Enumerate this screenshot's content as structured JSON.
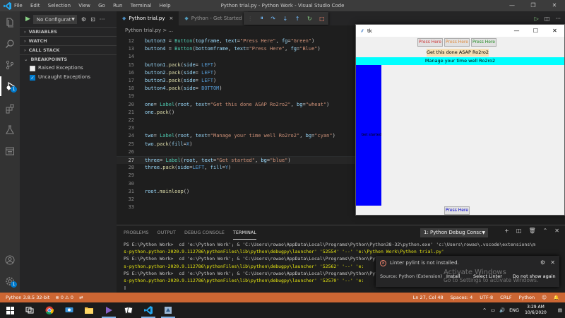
{
  "titlebar": {
    "menu": [
      "File",
      "Edit",
      "Selection",
      "View",
      "Go",
      "Run",
      "Terminal",
      "Help"
    ],
    "title": "Python trial.py - Python Work - Visual Studio Code"
  },
  "sidebar": {
    "config": "No Configurat",
    "sections": [
      "VARIABLES",
      "WATCH",
      "CALL STACK",
      "BREAKPOINTS"
    ],
    "breakpoints": [
      {
        "label": "Raised Exceptions",
        "checked": false
      },
      {
        "label": "Uncaught Exceptions",
        "checked": true
      }
    ]
  },
  "tabs": [
    {
      "label": "Python trial.py",
      "active": true
    },
    {
      "label": "Python - Get Started",
      "active": false
    }
  ],
  "breadcrumb": "Python trial.py > ...",
  "code": [
    {
      "n": "12",
      "t": "button3 = Button(topframe, text=\"Press Here\", fg=\"Green\")"
    },
    {
      "n": "13",
      "t": "button4 = Button(bottomframe, text=\"Press Here\", fg=\"Blue\")"
    },
    {
      "n": "14",
      "t": ""
    },
    {
      "n": "15",
      "t": "button1.pack(side= LEFT)"
    },
    {
      "n": "16",
      "t": "button2.pack(side= LEFT)"
    },
    {
      "n": "17",
      "t": "button3.pack(side= LEFT)"
    },
    {
      "n": "18",
      "t": "button4.pack(side= BOTTOM)"
    },
    {
      "n": "19",
      "t": ""
    },
    {
      "n": "20",
      "t": "one= Label(root, text=\"Get this done ASAP Ro2ro2\", bg=\"wheat\")"
    },
    {
      "n": "21",
      "t": "one.pack()"
    },
    {
      "n": "22",
      "t": ""
    },
    {
      "n": "23",
      "t": ""
    },
    {
      "n": "24",
      "t": "two= Label(root, text=\"Manage your time well Ro2ro2\", bg=\"cyan\")"
    },
    {
      "n": "25",
      "t": "two.pack(fill=X)"
    },
    {
      "n": "26",
      "t": ""
    },
    {
      "n": "27",
      "t": "three= Label(root, text=\"Get started\", bg=\"blue\")"
    },
    {
      "n": "28",
      "t": "three.pack(side=LEFT, fill=Y)"
    },
    {
      "n": "29",
      "t": ""
    },
    {
      "n": "30",
      "t": ""
    },
    {
      "n": "31",
      "t": "root.mainloop()"
    },
    {
      "n": "32",
      "t": ""
    },
    {
      "n": "33",
      "t": ""
    }
  ],
  "panel": {
    "tabs": [
      "PROBLEMS",
      "OUTPUT",
      "DEBUG CONSOLE",
      "TERMINAL"
    ],
    "terminal_select": "1: Python Debug Consc",
    "terminal": [
      "PS E:\\Python Work>  cd 'e:\\Python Work'; & 'C:\\Users\\rowao\\AppData\\Local\\Programs\\Python\\Python38-32\\python.exe' 'c:\\Users\\rowao\\.vscode\\extensions\\m",
      "s-python.python-2020.9.112786\\pythonFiles\\lib\\python\\debugpy\\launcher' '52554' '--' 'e:\\Python Work\\Python trial.py'",
      "PS E:\\Python Work>  cd 'e:\\Python Work'; & 'C:\\Users\\rowao\\AppData\\Local\\Programs\\Python\\Python38-32\\python.exe' 'c:\\Users\\rowao\\.vscode\\extensions\\m",
      "s-python.python-2020.9.112786\\pythonFiles\\lib\\python\\debugpy\\launcher' '52562' '--' 'e:",
      "PS E:\\Python Work>  cd 'e:\\Python Work'; & 'C:\\Users\\rowao\\AppData\\Local\\Programs\\Python\\Python38-32\\python.exe' 'c:\\",
      "s-python.python-2020.9.112786\\pythonFiles\\lib\\python\\debugpy\\launcher' '52570' '--' 'e:",
      "▯"
    ]
  },
  "notification": {
    "message": "Linter pylint is not installed.",
    "source": "Source: Python (Extension)",
    "buttons": [
      "Install",
      "Select Linter",
      "Do not show again"
    ]
  },
  "watermark": {
    "line1": "Activate Windows",
    "line2": "Go to Settings to activate Windows."
  },
  "statusbar": {
    "python": "Python 3.8.5 32-bit",
    "errors": "⊗ 0 ⚠ 0",
    "position": "Ln 27, Col 48",
    "spaces": "Spaces: 4",
    "encoding": "UTF-8",
    "eol": "CRLF",
    "language": "Python"
  },
  "taskbar": {
    "lang": "ENG",
    "time": "3:29 AM",
    "date": "10/6/2020"
  },
  "tk": {
    "title": "tk",
    "buttons": [
      "Press Here",
      "Press Here",
      "Press Here"
    ],
    "button_colors": [
      "#cc3333",
      "#e08a3c",
      "#228b22"
    ],
    "bottom_button": "Press Here",
    "label_one": "Get this done ASAP Ro2ro2",
    "label_two": "Manage your time well Ro2ro2",
    "label_three": "Get started"
  }
}
